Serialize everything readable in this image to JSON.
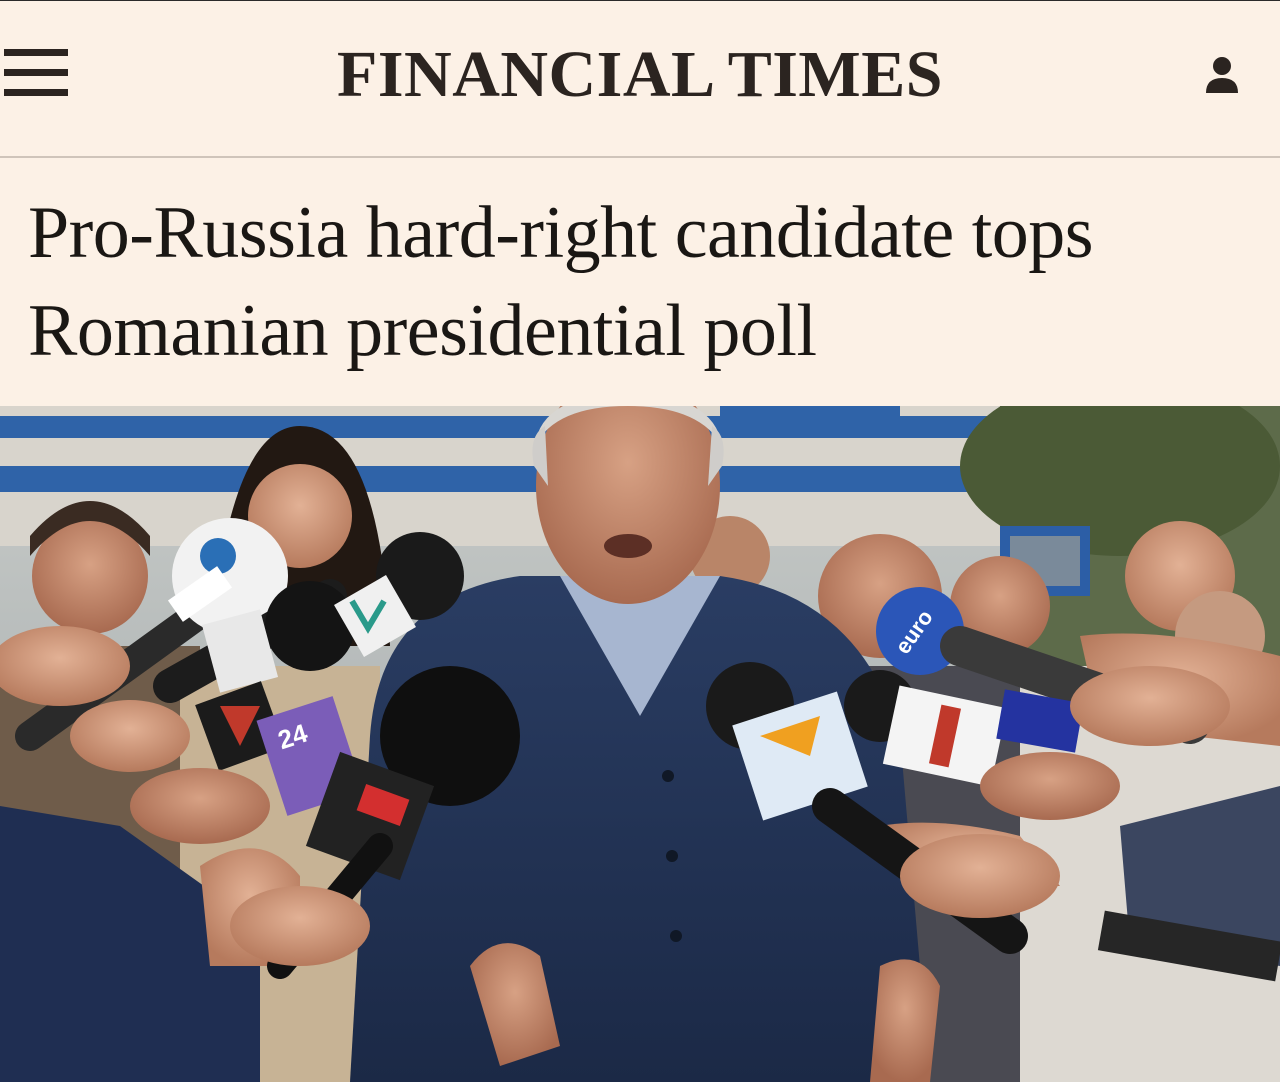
{
  "header": {
    "masthead": "FINANCIAL TIMES",
    "menu_icon": "hamburger-menu-icon",
    "account_icon": "user-account-icon"
  },
  "article": {
    "headline": "Pro-Russia hard-right candidate tops Romanian presidential poll"
  },
  "colors": {
    "background": "#fcf1e6",
    "text": "#1a1714"
  }
}
